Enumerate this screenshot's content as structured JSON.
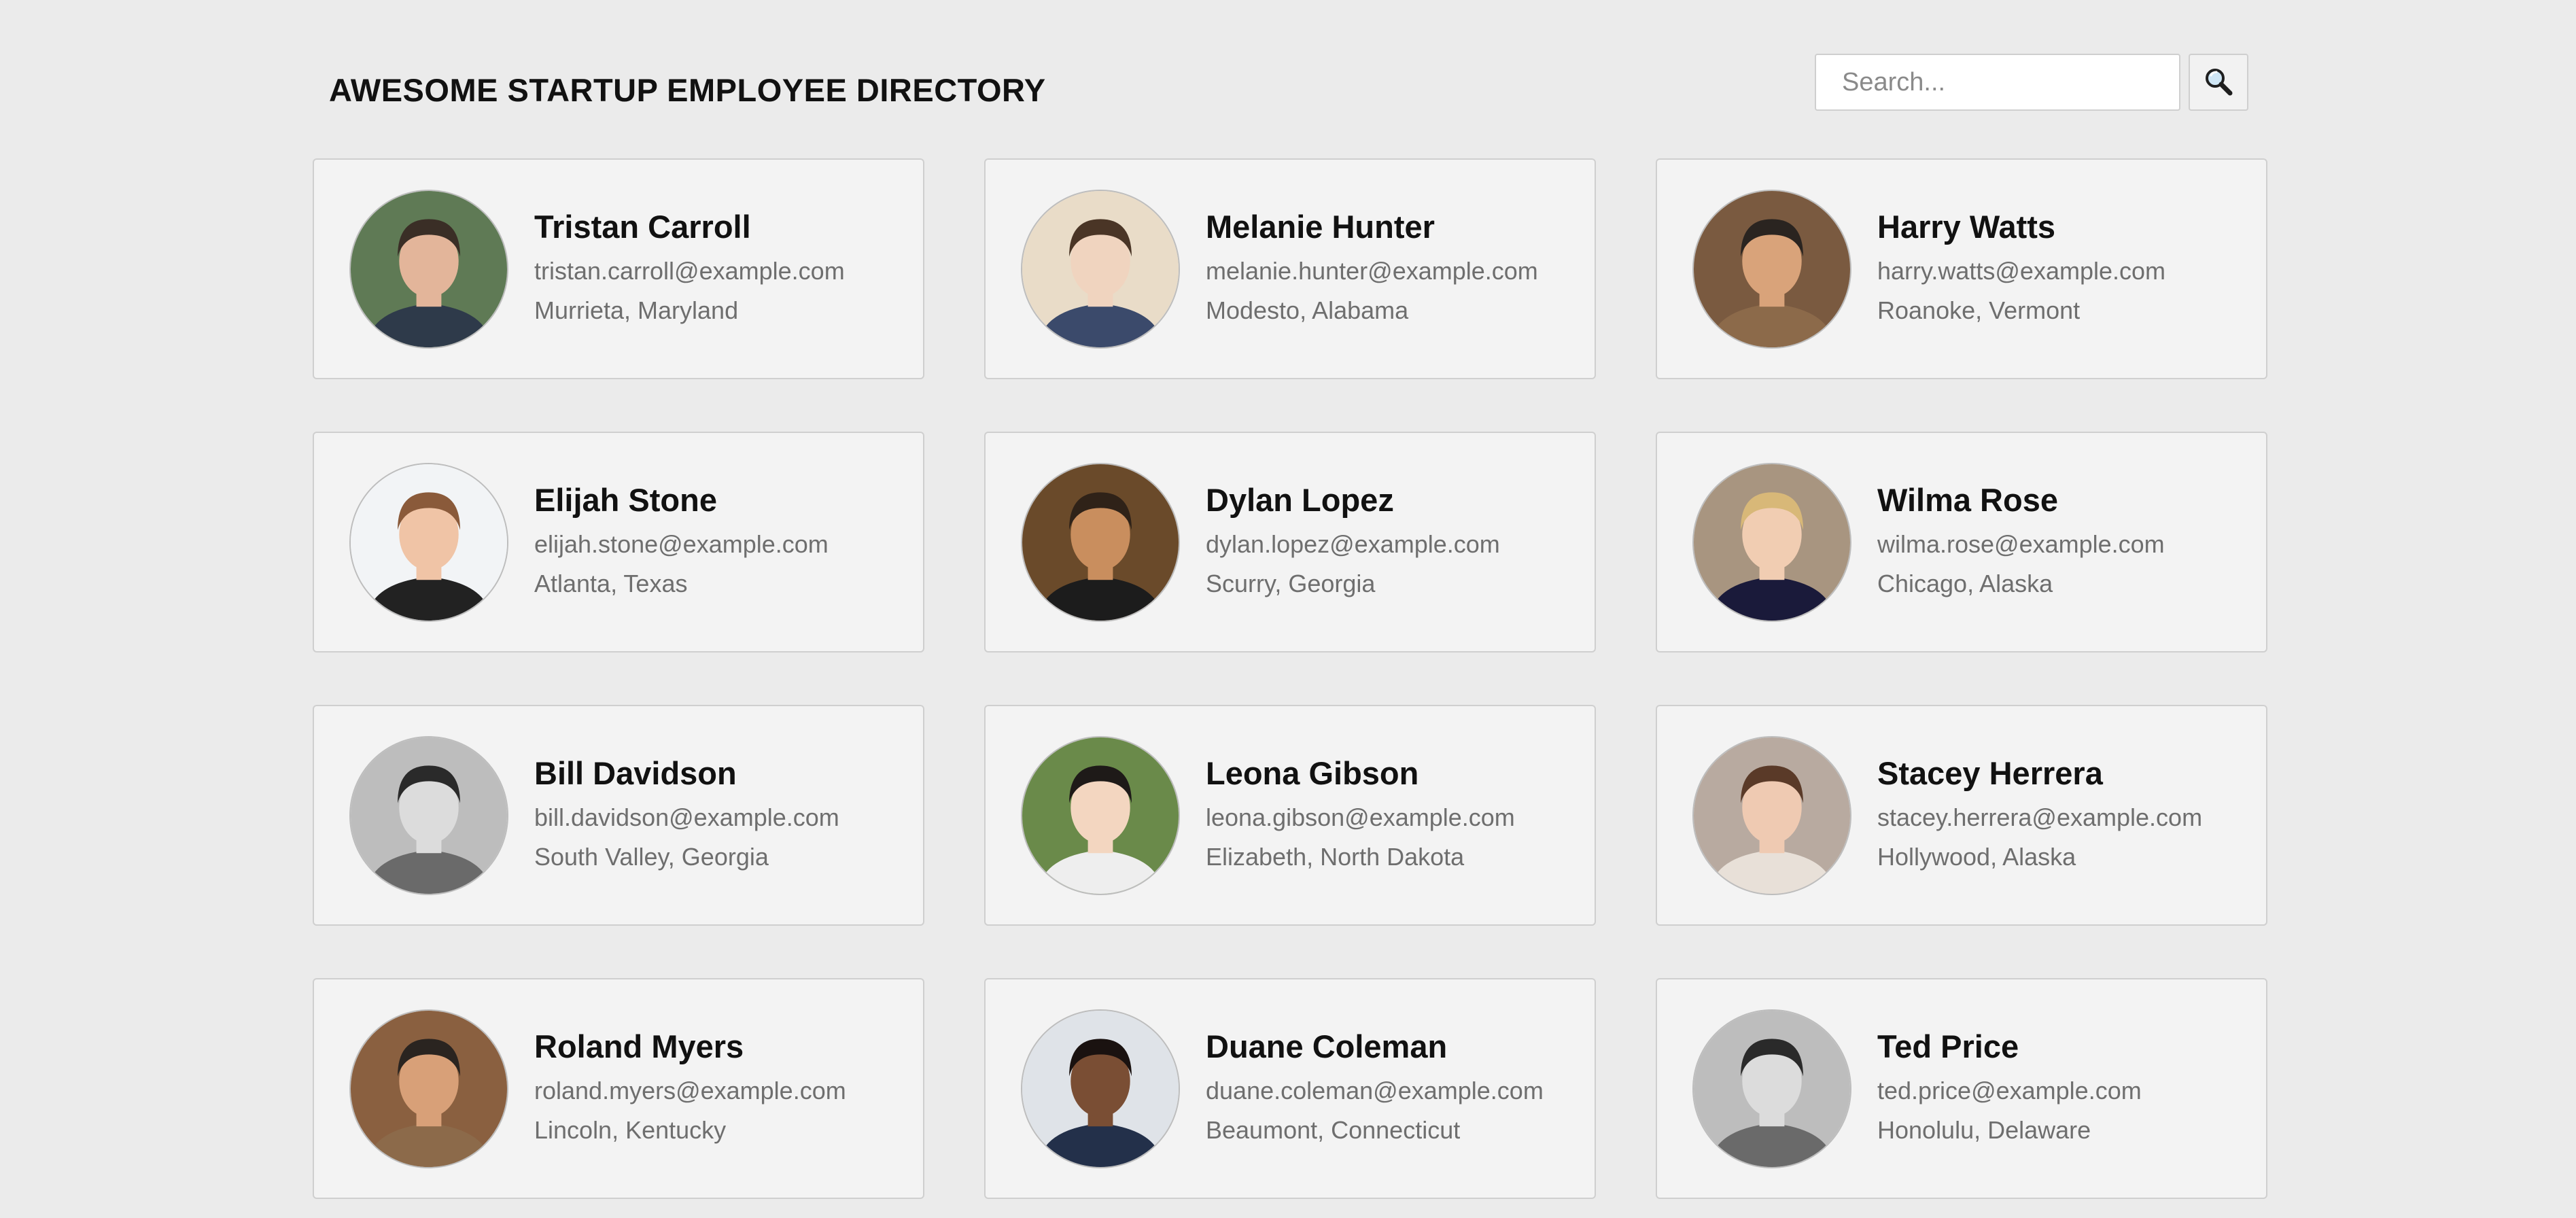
{
  "header": {
    "title": "AWESOME STARTUP EMPLOYEE DIRECTORY",
    "search": {
      "placeholder": "Search...",
      "value": "",
      "button_icon": "magnifying-glass-icon"
    }
  },
  "employees": [
    {
      "name": "Tristan Carroll",
      "email": "tristan.carroll@example.com",
      "location": "Murrieta, Maryland",
      "bg": "#5f7a55",
      "skin": "#e3b59a",
      "hair": "#3a2e26",
      "shirt": "#2e3a4a"
    },
    {
      "name": "Melanie Hunter",
      "email": "melanie.hunter@example.com",
      "location": "Modesto, Alabama",
      "bg": "#e9dcc8",
      "skin": "#f0d4bf",
      "hair": "#4a3526",
      "shirt": "#3b4a6b"
    },
    {
      "name": "Harry Watts",
      "email": "harry.watts@example.com",
      "location": "Roanoke, Vermont",
      "bg": "#7a5a40",
      "skin": "#d9a37a",
      "hair": "#2a2420",
      "shirt": "#8c6a4a"
    },
    {
      "name": "Elijah Stone",
      "email": "elijah.stone@example.com",
      "location": "Atlanta, Texas",
      "bg": "#f2f4f6",
      "skin": "#f0c4a6",
      "hair": "#8a5a3a",
      "shirt": "#222222"
    },
    {
      "name": "Dylan Lopez",
      "email": "dylan.lopez@example.com",
      "location": "Scurry, Georgia",
      "bg": "#6a4a2a",
      "skin": "#c98e5e",
      "hair": "#2f2218",
      "shirt": "#1c1c1c"
    },
    {
      "name": "Wilma Rose",
      "email": "wilma.rose@example.com",
      "location": "Chicago, Alaska",
      "bg": "#a89580",
      "skin": "#f1cdb2",
      "hair": "#d8b878",
      "shirt": "#1a1a3a"
    },
    {
      "name": "Bill Davidson",
      "email": "bill.davidson@example.com",
      "location": "South Valley, Georgia",
      "bg": "#bdbdbd",
      "skin": "#dcdcdc",
      "hair": "#2a2a2a",
      "shirt": "#6a6a6a"
    },
    {
      "name": "Leona Gibson",
      "email": "leona.gibson@example.com",
      "location": "Elizabeth, North Dakota",
      "bg": "#6a8a4a",
      "skin": "#f3d6c0",
      "hair": "#1e1a18",
      "shirt": "#eeeeee"
    },
    {
      "name": "Stacey Herrera",
      "email": "stacey.herrera@example.com",
      "location": "Hollywood, Alaska",
      "bg": "#b8aaa0",
      "skin": "#efcab2",
      "hair": "#5a3a28",
      "shirt": "#e8e0d8"
    },
    {
      "name": "Roland Myers",
      "email": "roland.myers@example.com",
      "location": "Lincoln, Kentucky",
      "bg": "#8a6040",
      "skin": "#d8a078",
      "hair": "#2a2420",
      "shirt": "#8c6a4a"
    },
    {
      "name": "Duane Coleman",
      "email": "duane.coleman@example.com",
      "location": "Beaumont, Connecticut",
      "bg": "#dfe3e8",
      "skin": "#7a4e34",
      "hair": "#1a1210",
      "shirt": "#23304a"
    },
    {
      "name": "Ted Price",
      "email": "ted.price@example.com",
      "location": "Honolulu, Delaware",
      "bg": "#bdbdbd",
      "skin": "#dcdcdc",
      "hair": "#2a2a2a",
      "shirt": "#6a6a6a"
    }
  ]
}
